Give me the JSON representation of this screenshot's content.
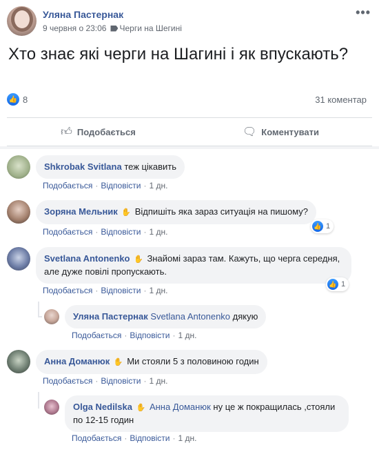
{
  "post": {
    "author": "Уляна Пастернак",
    "date": "9 червня о 23:06",
    "group": "Черги на Шегині",
    "text": "Хто знає які черги на Шагині і як впускають?",
    "likes": "8",
    "comments_count": "31 коментар",
    "menu": "•••",
    "like_button": "Подобається",
    "comment_button": "Коментувати"
  },
  "comment_actions": {
    "like": "Подобається",
    "reply": "Відповісти",
    "sep": "·",
    "time": "1 дн."
  },
  "comments": [
    {
      "author": "Shkrobak Svitlana",
      "text": "теж цікавить"
    },
    {
      "author": "Зоряна Мельник",
      "text": "Відпишіть яка зараз ситуація на пишому?",
      "reactions": "1"
    },
    {
      "author": "Svetlana Antonenko",
      "text": "Знайомі зараз там. Кажуть, що черга середня, але дуже повілі пропускають.",
      "reactions": "1"
    },
    {
      "author": "Уляна Пастернак",
      "mention": "Svetlana Antonenko",
      "text": "дякую"
    },
    {
      "author": "Анна Доманюк",
      "text": "Ми стояли 5 з половиною годин"
    },
    {
      "author": "Olga Nedilska",
      "mention": "Анна Доманюк",
      "text": "ну це ж покращилась ,стояли по 12-15 годин"
    }
  ],
  "icons": {
    "like": "thumbs-up-icon",
    "comment": "speech-bubble-icon",
    "tag": "tag-icon",
    "wave": "hand-wave-icon"
  },
  "colors": {
    "link": "#385898",
    "bubble": "#f2f3f5",
    "like_blue": "#1467e6"
  }
}
